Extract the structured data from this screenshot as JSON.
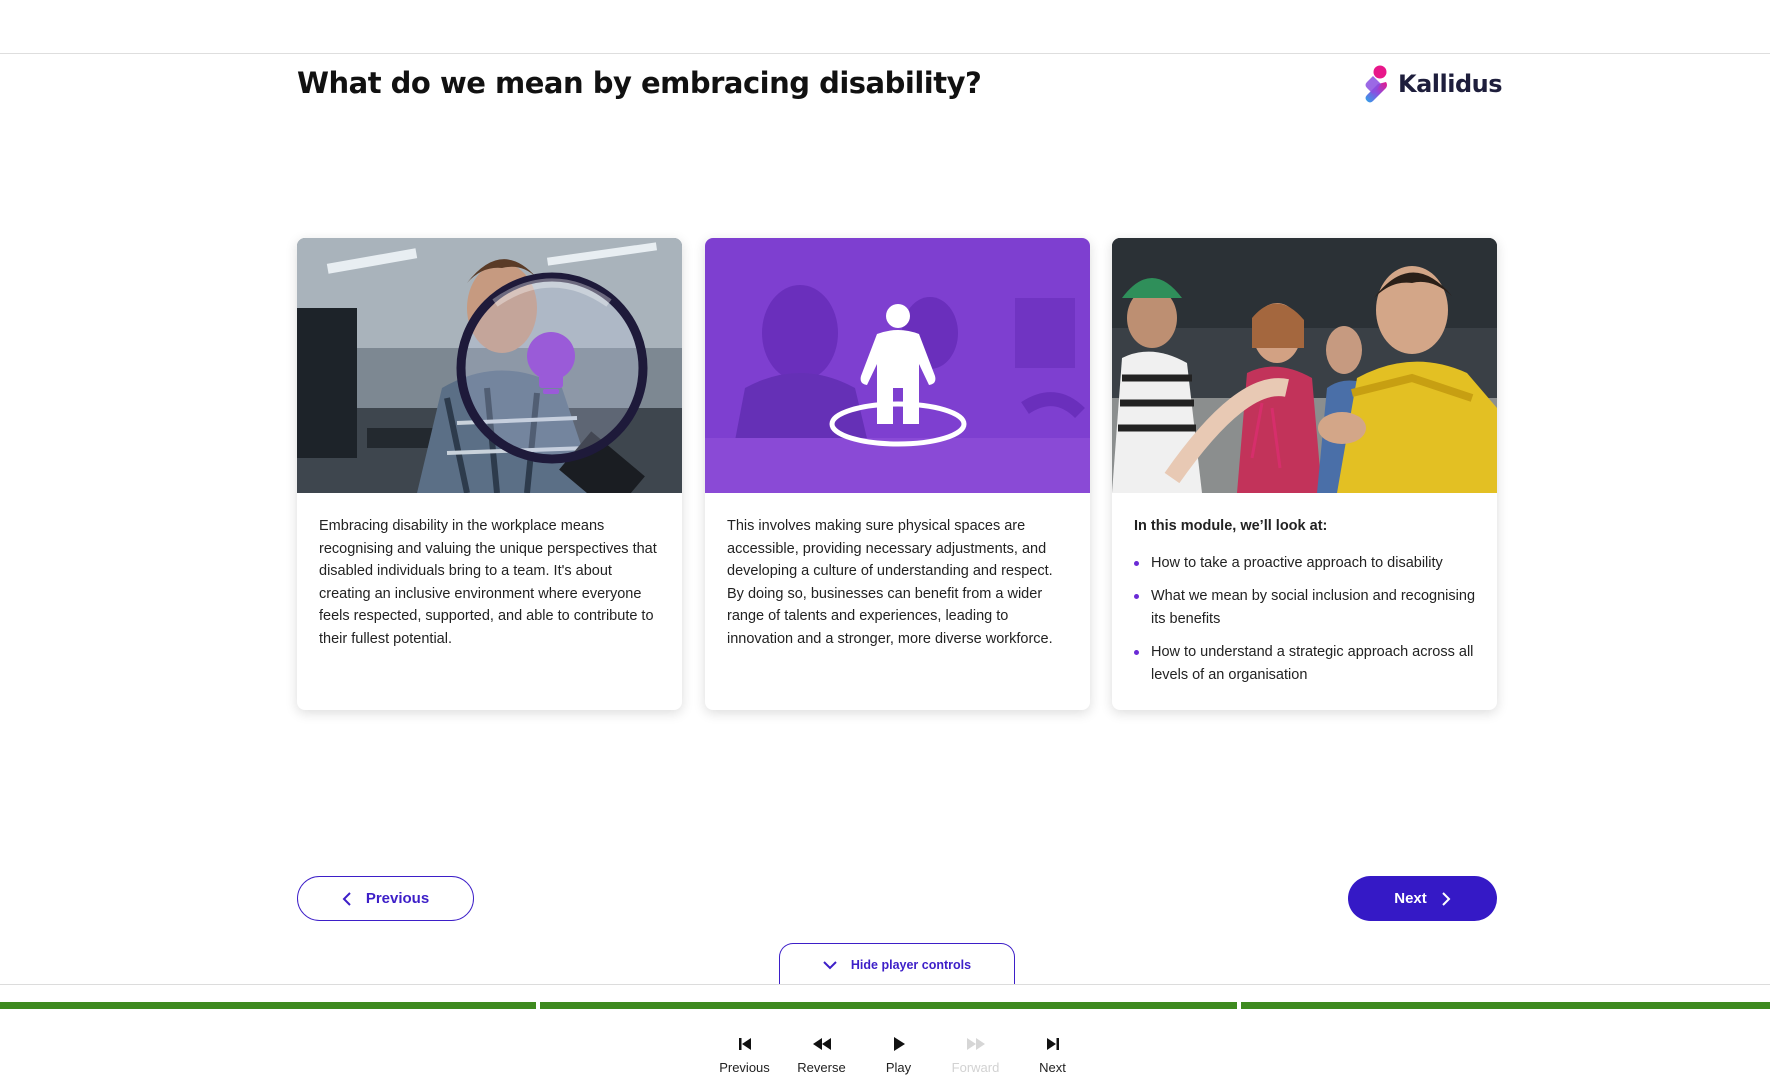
{
  "page": {
    "title": "What do we mean by embracing disability?"
  },
  "brand": {
    "name": "Kallidus",
    "colors": {
      "pink": "#e8178a",
      "purple": "#8a4fe0",
      "blue": "#2aa8e8"
    }
  },
  "cards": [
    {
      "image_icon": "magnifier-lightbulb-icon",
      "text": "Embracing disability in the workplace means recognising and valuing the unique perspectives that disabled individuals bring to a team. It's about creating an inclusive environment where everyone feels respected, supported, and able to contribute to their fullest potential."
    },
    {
      "image_icon": "person-standing-icon",
      "text": "This involves making sure physical spaces are accessible, providing necessary adjustments, and developing a culture of understanding and respect. By doing so, businesses can benefit from a wider range of talents and experiences, leading to innovation and a stronger, more diverse workforce."
    },
    {
      "intro": "In this module, we’ll look at:",
      "items": [
        "How to take a proactive approach to disability",
        "What we mean by social inclusion and recognising its benefits",
        "How to understand a strategic approach across all levels of an organisation"
      ]
    }
  ],
  "nav": {
    "previous_label": "Previous",
    "next_label": "Next"
  },
  "player": {
    "hide_controls_label": "Hide player controls",
    "progress_segments": 3,
    "progress_color": "#3e8a1f",
    "controls": [
      {
        "label": "Previous",
        "icon": "skip-previous-icon",
        "enabled": true
      },
      {
        "label": "Reverse",
        "icon": "rewind-icon",
        "enabled": true
      },
      {
        "label": "Play",
        "icon": "play-icon",
        "enabled": true
      },
      {
        "label": "Forward",
        "icon": "fast-forward-icon",
        "enabled": false
      },
      {
        "label": "Next",
        "icon": "skip-next-icon",
        "enabled": true
      }
    ]
  },
  "colors": {
    "accent": "#3519c6",
    "card_purple": "#7e3fd0"
  }
}
